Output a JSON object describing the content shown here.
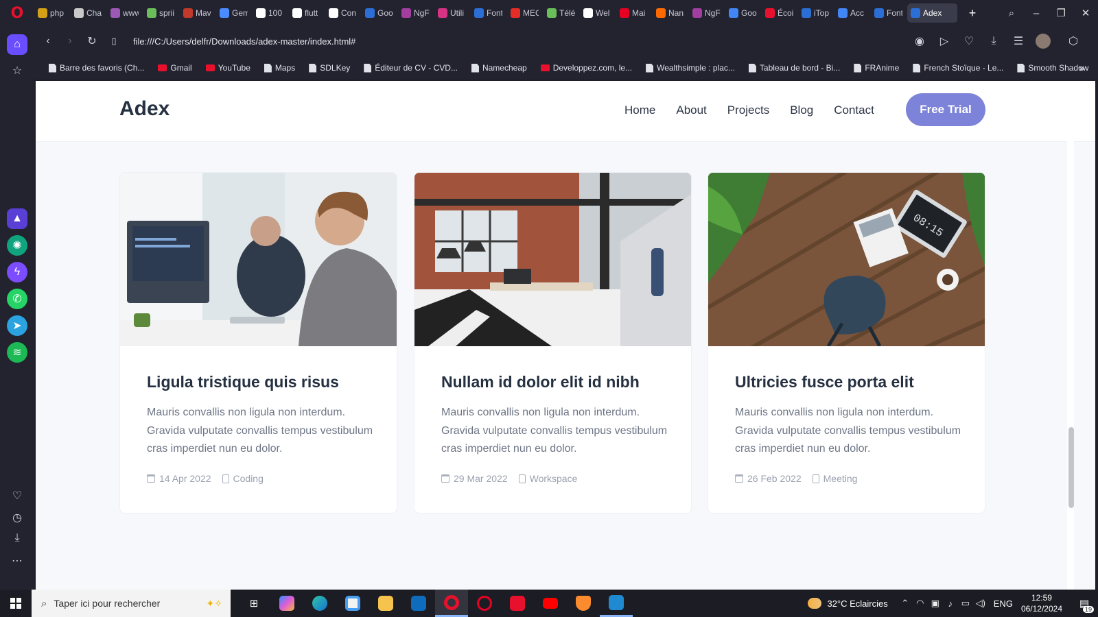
{
  "browser": {
    "tabs": [
      {
        "label": "php",
        "color": "#d4a017"
      },
      {
        "label": "Cha",
        "color": "#c9c9c9"
      },
      {
        "label": "www",
        "color": "#9b59b6"
      },
      {
        "label": "sprii",
        "color": "#6bbf59"
      },
      {
        "label": "Mav",
        "color": "#c0392b"
      },
      {
        "label": "Gem",
        "color": "#4a8cff"
      },
      {
        "label": "100",
        "color": "#ffffff"
      },
      {
        "label": "flutt",
        "color": "#ffffff"
      },
      {
        "label": "Con",
        "color": "#ffffff"
      },
      {
        "label": "Goo",
        "color": "#2b6fd6"
      },
      {
        "label": "NgF",
        "color": "#a23ea0"
      },
      {
        "label": "Utili",
        "color": "#d63384"
      },
      {
        "label": "Font",
        "color": "#2b6fd6"
      },
      {
        "label": "MEC",
        "color": "#e52d27"
      },
      {
        "label": "Télé",
        "color": "#6bbf59"
      },
      {
        "label": "Wel",
        "color": "#ffffff"
      },
      {
        "label": "Mai",
        "color": "#e60023"
      },
      {
        "label": "Nan",
        "color": "#ff6a00"
      },
      {
        "label": "NgF",
        "color": "#a23ea0"
      },
      {
        "label": "Goo",
        "color": "#4285f4"
      },
      {
        "label": "Écoi",
        "color": "#e8112d"
      },
      {
        "label": "iTop",
        "color": "#2b6fd6"
      },
      {
        "label": "Acc",
        "color": "#4285f4"
      },
      {
        "label": "Font",
        "color": "#2b6fd6"
      }
    ],
    "active_tab": {
      "label": "Adex",
      "color": "#2b6fd6"
    },
    "new_tab_symbol": "+",
    "url": "file:///C:/Users/delfr/Downloads/adex-master/index.html#",
    "bookmarks": [
      {
        "label": "Barre des favoris (Ch...",
        "icon": "folder-icon"
      },
      {
        "label": "Gmail",
        "icon": "gmail-icon"
      },
      {
        "label": "YouTube",
        "icon": "youtube-icon"
      },
      {
        "label": "Maps",
        "icon": "page-icon"
      },
      {
        "label": "SDLKey",
        "icon": "page-icon"
      },
      {
        "label": "Éditeur de CV - CVD...",
        "icon": "page-icon"
      },
      {
        "label": "Namecheap",
        "icon": "page-icon"
      },
      {
        "label": "Developpez.com, le...",
        "icon": "developpez-icon"
      },
      {
        "label": "Wealthsimple : plac...",
        "icon": "page-icon"
      },
      {
        "label": "Tableau de bord - Bi...",
        "icon": "page-icon"
      },
      {
        "label": "FRAnime",
        "icon": "page-icon"
      },
      {
        "label": "French Stoïque - Le...",
        "icon": "page-icon"
      },
      {
        "label": "Smooth Shadow",
        "icon": "page-icon"
      }
    ]
  },
  "site": {
    "logo": "Adex",
    "menu": [
      "Home",
      "About",
      "Projects",
      "Blog",
      "Contact"
    ],
    "cta": "Free Trial",
    "accent": "#7c83d8"
  },
  "posts": [
    {
      "title": "Ligula tristique quis risus",
      "excerpt": "Mauris convallis non ligula non interdum. Gravida vulputate convallis tempus vestibulum cras imperdiet nun eu dolor.",
      "date": "14 Apr 2022",
      "category": "Coding"
    },
    {
      "title": "Nullam id dolor elit id nibh",
      "excerpt": "Mauris convallis non ligula non interdum. Gravida vulputate convallis tempus vestibulum cras imperdiet nun eu dolor.",
      "date": "29 Mar 2022",
      "category": "Workspace"
    },
    {
      "title": "Ultricies fusce porta elit",
      "excerpt": "Mauris convallis non ligula non interdum. Gravida vulputate convallis tempus vestibulum cras imperdiet nun eu dolor.",
      "date": "26 Feb 2022",
      "category": "Meeting"
    }
  ],
  "taskbar": {
    "search_placeholder": "Taper ici pour rechercher",
    "weather": "32°C  Eclaircies",
    "language": "ENG",
    "time": "12:59",
    "date": "06/12/2024",
    "notifications": "19"
  }
}
